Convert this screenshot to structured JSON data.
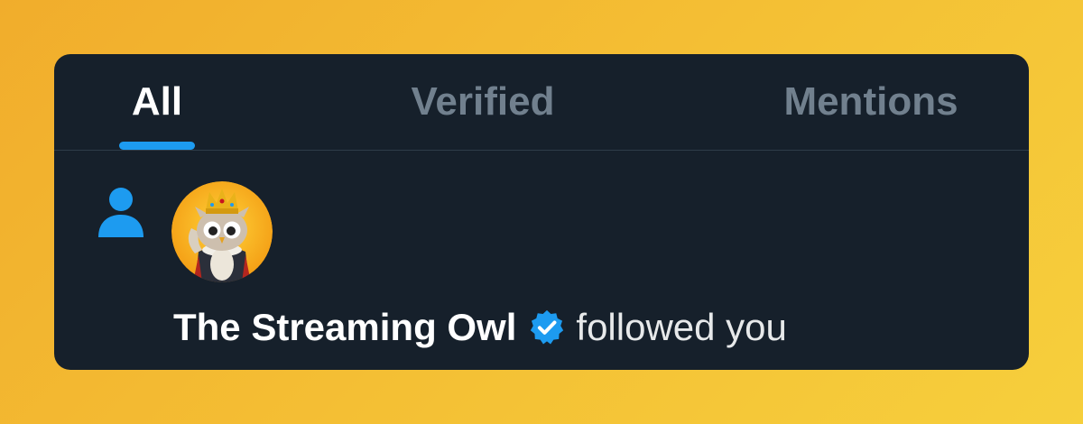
{
  "tabs": [
    {
      "label": "All",
      "active": true
    },
    {
      "label": "Verified",
      "active": false
    },
    {
      "label": "Mentions",
      "active": false
    }
  ],
  "notification": {
    "icon": "person-icon",
    "avatar": "owl-with-crown-avatar",
    "display_name": "The Streaming Owl",
    "verified": true,
    "action": "followed you"
  },
  "colors": {
    "background_gradient_start": "#f1ad2c",
    "background_gradient_end": "#f6cf3c",
    "card": "#16202b",
    "accent": "#1d9bf0",
    "active_tab_text": "#ffffff",
    "inactive_tab_text": "#71808e",
    "divider": "#2f3d49"
  }
}
